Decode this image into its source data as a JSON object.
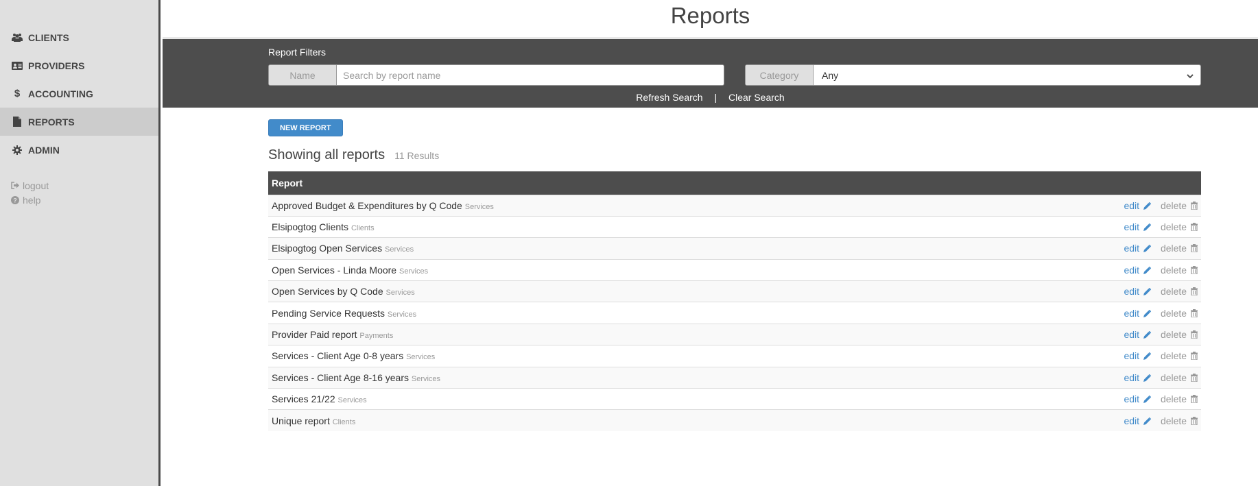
{
  "sidebar": {
    "items": [
      {
        "label": "CLIENTS",
        "icon": "users-icon",
        "active": false
      },
      {
        "label": "PROVIDERS",
        "icon": "id-card-icon",
        "active": false
      },
      {
        "label": "ACCOUNTING",
        "icon": "dollar-icon",
        "active": false
      },
      {
        "label": "REPORTS",
        "icon": "file-icon",
        "active": true
      },
      {
        "label": "ADMIN",
        "icon": "gear-icon",
        "active": false
      }
    ],
    "logout": "logout",
    "help": "help"
  },
  "header": {
    "title": "Reports"
  },
  "filters": {
    "label": "Report Filters",
    "name_addon": "Name",
    "name_placeholder": "Search by report name",
    "name_value": "",
    "category_addon": "Category",
    "category_selected": "Any",
    "refresh": "Refresh Search",
    "separator": "|",
    "clear": "Clear Search"
  },
  "content": {
    "new_button": "NEW REPORT",
    "heading": "Showing all reports",
    "count": "11 Results",
    "column_header": "Report",
    "edit_label": "edit",
    "delete_label": "delete",
    "rows": [
      {
        "name": "Approved Budget & Expenditures by Q Code",
        "category": "Services"
      },
      {
        "name": "Elsipogtog Clients",
        "category": "Clients"
      },
      {
        "name": "Elsipogtog Open Services",
        "category": "Services"
      },
      {
        "name": "Open Services - Linda Moore",
        "category": "Services"
      },
      {
        "name": "Open Services by Q Code",
        "category": "Services"
      },
      {
        "name": "Pending Service Requests",
        "category": "Services"
      },
      {
        "name": "Provider Paid report",
        "category": "Payments"
      },
      {
        "name": "Services - Client Age 0-8 years",
        "category": "Services"
      },
      {
        "name": "Services - Client Age 8-16 years",
        "category": "Services"
      },
      {
        "name": "Services 21/22",
        "category": "Services"
      },
      {
        "name": "Unique report",
        "category": "Clients"
      }
    ]
  },
  "colors": {
    "accent": "#428bca",
    "dark_band": "#4d4d4d",
    "sidebar_bg": "#e0e0e0",
    "active_item": "#cccccc"
  }
}
